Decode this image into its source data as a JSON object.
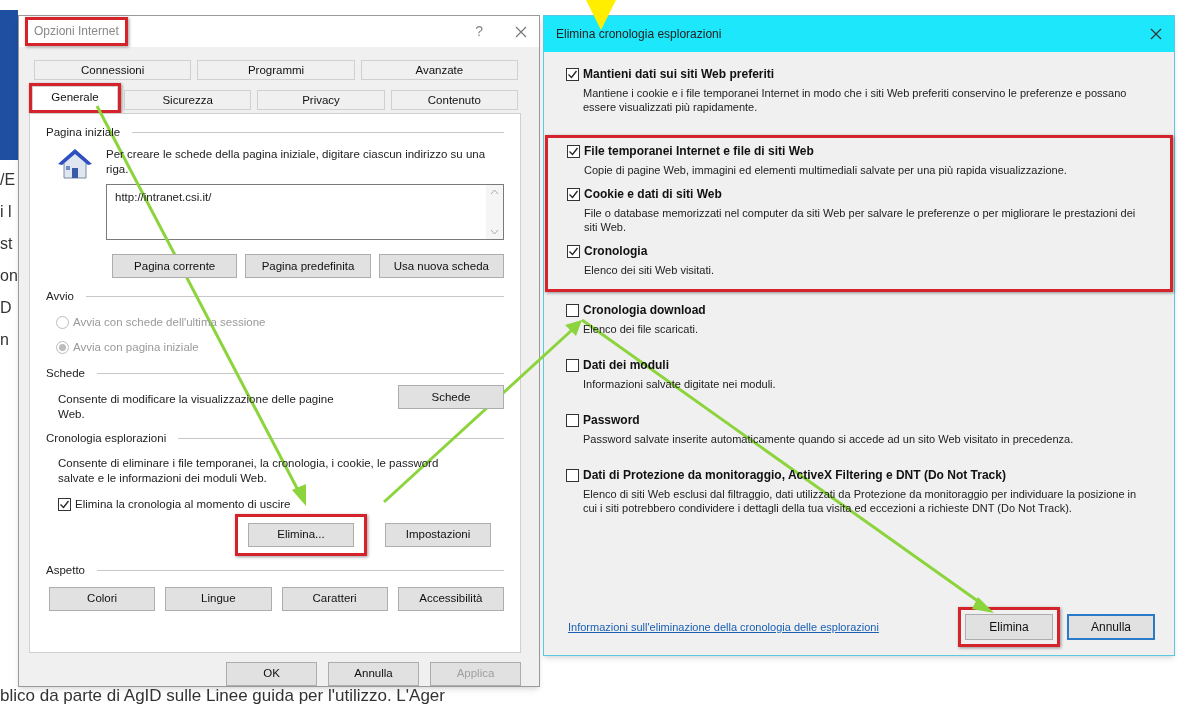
{
  "background_page": {
    "fragments": [
      "/E",
      "i l",
      "st",
      "on",
      "D",
      "n"
    ],
    "footer_text": "blico da parte di AgID sulle Linee guida per l'utilizzo. L'Ager"
  },
  "options_dialog": {
    "title": "Opzioni Internet",
    "title_highlighted": true,
    "help": "?",
    "tab_rows": [
      [
        {
          "label": "Connessioni",
          "selected": false,
          "highlighted": false
        },
        {
          "label": "Programmi",
          "selected": false,
          "highlighted": false
        },
        {
          "label": "Avanzate",
          "selected": false,
          "highlighted": false
        }
      ],
      [
        {
          "label": "Generale",
          "selected": true,
          "highlighted": true
        },
        {
          "label": "Sicurezza",
          "selected": false,
          "highlighted": false
        },
        {
          "label": "Privacy",
          "selected": false,
          "highlighted": false
        },
        {
          "label": "Contenuto",
          "selected": false,
          "highlighted": false
        }
      ]
    ],
    "home_page": {
      "legend": "Pagina iniziale",
      "description": "Per creare le schede della pagina iniziale, digitare ciascun indirizzo su una riga.",
      "url": "http://intranet.csi.it/",
      "buttons": [
        "Pagina corrente",
        "Pagina predefinita",
        "Usa nuova scheda"
      ]
    },
    "startup": {
      "legend": "Avvio",
      "options": [
        {
          "label": "Avvia con schede dell'ultima sessione",
          "selected": false,
          "disabled": true
        },
        {
          "label": "Avvia con pagina iniziale",
          "selected": true,
          "disabled": true
        }
      ]
    },
    "tabs_section": {
      "legend": "Schede",
      "description": "Consente di modificare la visualizzazione delle pagine Web.",
      "button": "Schede"
    },
    "history": {
      "legend": "Cronologia esplorazioni",
      "description": "Consente di eliminare i file temporanei, la cronologia, i cookie, le password salvate e le informazioni dei moduli Web.",
      "checkbox": {
        "label": "Elimina la cronologia al momento di uscire",
        "checked": true
      },
      "buttons": [
        {
          "label": "Elimina...",
          "highlighted": true
        },
        {
          "label": "Impostazioni",
          "highlighted": false
        }
      ]
    },
    "appearance": {
      "legend": "Aspetto",
      "buttons": [
        "Colori",
        "Lingue",
        "Caratteri",
        "Accessibilità"
      ]
    },
    "footer_buttons": [
      {
        "label": "OK",
        "disabled": false
      },
      {
        "label": "Annulla",
        "disabled": false
      },
      {
        "label": "Applica",
        "disabled": true
      }
    ]
  },
  "delete_dialog": {
    "title": "Elimina cronologia esplorazioni",
    "groups": [
      {
        "highlighted": false,
        "items": [
          {
            "title": "Mantieni dati sui siti Web preferiti",
            "description": "Mantiene i cookie e i file temporanei Internet in modo che i siti Web preferiti conservino le preferenze e possano essere visualizzati più rapidamente.",
            "checked": true
          }
        ]
      },
      {
        "highlighted": true,
        "items": [
          {
            "title": "File temporanei Internet e file di siti Web",
            "description": "Copie di pagine Web, immagini ed elementi multimediali salvate per una più rapida visualizzazione.",
            "checked": true
          },
          {
            "title": "Cookie e dati di siti Web",
            "description": "File o database memorizzati nel computer da siti Web per salvare le preferenze o per migliorare le prestazioni dei siti Web.",
            "checked": true
          },
          {
            "title": "Cronologia",
            "description": "Elenco dei siti Web visitati.",
            "checked": true
          }
        ]
      },
      {
        "highlighted": false,
        "items": [
          {
            "title": "Cronologia download",
            "description": "Elenco dei file scaricati.",
            "checked": false
          },
          {
            "title": "Dati dei moduli",
            "description": "Informazioni salvate digitate nei moduli.",
            "checked": false
          },
          {
            "title": "Password",
            "description": "Password salvate inserite automaticamente quando si accede ad un sito Web visitato in precedenza.",
            "checked": false
          },
          {
            "title": "Dati di Protezione da monitoraggio, ActiveX Filtering e DNT (Do Not Track)",
            "description": "Elenco di siti Web esclusi dal filtraggio, dati utilizzati da Protezione da monitoraggio per individuare la posizione in cui i siti potrebbero condividere i dettagli della tua visita ed eccezioni a richieste DNT (Do Not Track).",
            "checked": false
          }
        ]
      }
    ],
    "link": "Informazioni sull'eliminazione della cronologia delle esplorazioni",
    "buttons": [
      {
        "label": "Elimina",
        "highlighted": true,
        "default": false
      },
      {
        "label": "Annulla",
        "highlighted": false,
        "default": true
      }
    ]
  }
}
